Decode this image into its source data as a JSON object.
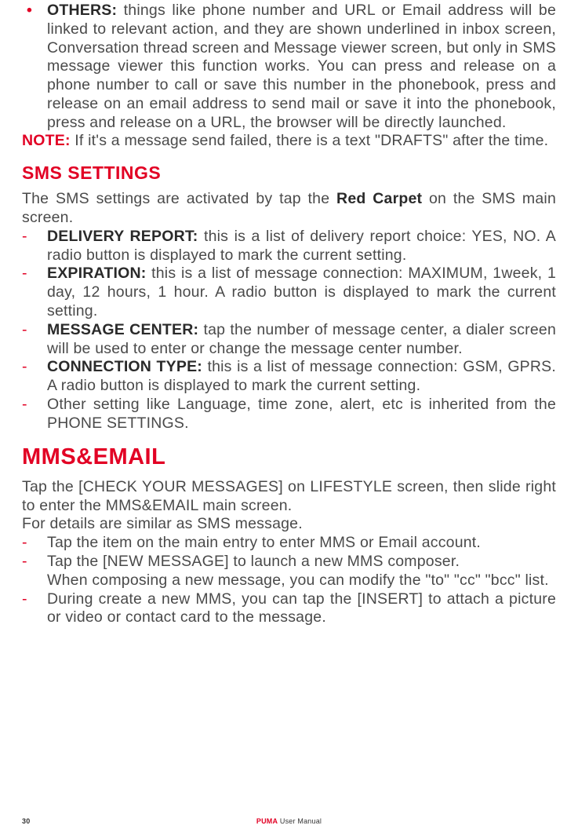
{
  "others": {
    "label": "OTHERS:",
    "text": " things like phone number and URL or Email address will be linked to relevant action, and they are shown underlined in inbox screen, Conversation thread screen and Message viewer screen, but only in SMS message viewer this function works. You can press and release on a phone number to call or save this number in the phonebook, press and release on an email address to send mail or save it into the phonebook, press and release on a URL, the browser will be directly launched."
  },
  "note": {
    "label": "NOTE:",
    "text": " If it's a message send failed, there is a text \"DRAFTS\" after the time."
  },
  "sms_heading": "SMS SETTINGS",
  "sms_intro_a": "The SMS settings are activated by tap the ",
  "sms_intro_bold": "Red Carpet",
  "sms_intro_b": " on the SMS main screen.",
  "sms_items": [
    {
      "label": "DELIVERY REPORT:",
      "text": " this is a list of delivery report choice: YES, NO. A radio button is displayed to mark the current setting."
    },
    {
      "label": "EXPIRATION:",
      "text": " this is a list of message connection: MAXIMUM, 1week, 1 day, 12 hours, 1 hour. A radio button is displayed to mark the current setting."
    },
    {
      "label": "MESSAGE CENTER:",
      "text": " tap the number of message center, a dialer screen will be used to enter or change the message center number."
    },
    {
      "label": "CONNECTION TYPE:",
      "text": " this is a list of message connection: GSM, GPRS. A radio button is displayed to mark the current setting."
    },
    {
      "label": "",
      "text": "Other setting like Language, time zone, alert, etc is inherited from the PHONE SETTINGS."
    }
  ],
  "mms_heading": "MMS&EMAIL",
  "mms_intro": "Tap the [CHECK YOUR MESSAGES] on LIFESTYLE screen, then slide right to enter the MMS&EMAIL main screen.",
  "mms_intro2": "For details are similar as SMS message.",
  "mms_items": [
    {
      "text": "Tap the item on the main entry to enter MMS or Email account."
    },
    {
      "text": "Tap the [NEW MESSAGE] to launch a new MMS composer."
    },
    {
      "text": "During create a new MMS, you can tap the [INSERT] to attach a picture or video or contact card to the message."
    }
  ],
  "mms_extra": "When composing a new message, you can modify the \"to\" \"cc\" \"bcc\" list.",
  "footer": {
    "page": "30",
    "brand": "PUMA",
    "label": " User Manual"
  }
}
